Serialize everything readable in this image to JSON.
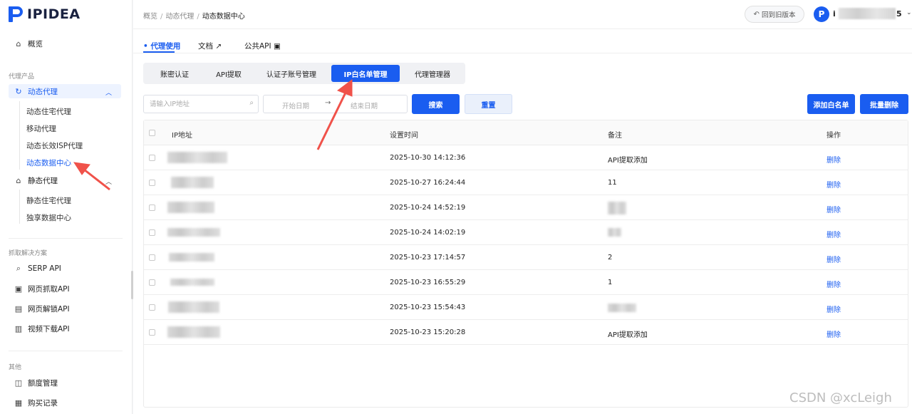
{
  "brand": {
    "name": "IPIDEA"
  },
  "sidebar": {
    "overview": "概览",
    "group_proxy": "代理产品",
    "dynamic": "动态代理",
    "dynamic_sub": [
      "动态住宅代理",
      "移动代理",
      "动态长效ISP代理",
      "动态数据中心"
    ],
    "static": "静态代理",
    "static_sub": [
      "静态住宅代理",
      "独享数据中心"
    ],
    "group_scrape": "抓取解决方案",
    "scrape_items": [
      "SERP API",
      "网页抓取API",
      "网页解锁API",
      "视频下载API"
    ],
    "group_other": "其他",
    "other_items": [
      "额度管理",
      "购买记录"
    ]
  },
  "header": {
    "breadcrumb": [
      "概览",
      "动态代理",
      "动态数据中心"
    ],
    "old_version": "回到旧版本",
    "avatar": "P",
    "user_prefix": "i",
    "user_suffix": "5"
  },
  "topnav": {
    "items": [
      "代理使用",
      "文档",
      "公共API"
    ]
  },
  "segments": [
    "账密认证",
    "API提取",
    "认证子账号管理",
    "IP白名单管理",
    "代理管理器"
  ],
  "filters": {
    "ip_placeholder": "请输入IP地址",
    "start_date": "开始日期",
    "end_date": "结束日期",
    "search": "搜索",
    "reset": "重置",
    "add_whitelist": "添加白名单",
    "batch_delete": "批量删除"
  },
  "table": {
    "headers": [
      "IP地址",
      "设置时间",
      "备注",
      "操作"
    ],
    "rows": [
      {
        "time": "2025-10-30 14:12:36",
        "note": "API提取添加",
        "action": "删除"
      },
      {
        "time": "2025-10-27 16:24:44",
        "note": "11",
        "action": "删除"
      },
      {
        "time": "2025-10-24 14:52:19",
        "note": "",
        "action": "删除"
      },
      {
        "time": "2025-10-24 14:02:19",
        "note": "",
        "action": "删除"
      },
      {
        "time": "2025-10-23 17:14:57",
        "note": "2",
        "action": "删除"
      },
      {
        "time": "2025-10-23 16:55:29",
        "note": "1",
        "action": "删除"
      },
      {
        "time": "2025-10-23 15:54:43",
        "note": "",
        "action": "删除"
      },
      {
        "time": "2025-10-23 15:20:28",
        "note": "API提取添加",
        "action": "删除"
      }
    ]
  },
  "watermark": "CSDN @xcLeigh",
  "colors": {
    "accent": "#1a5df0",
    "annotation": "#f0524a"
  }
}
